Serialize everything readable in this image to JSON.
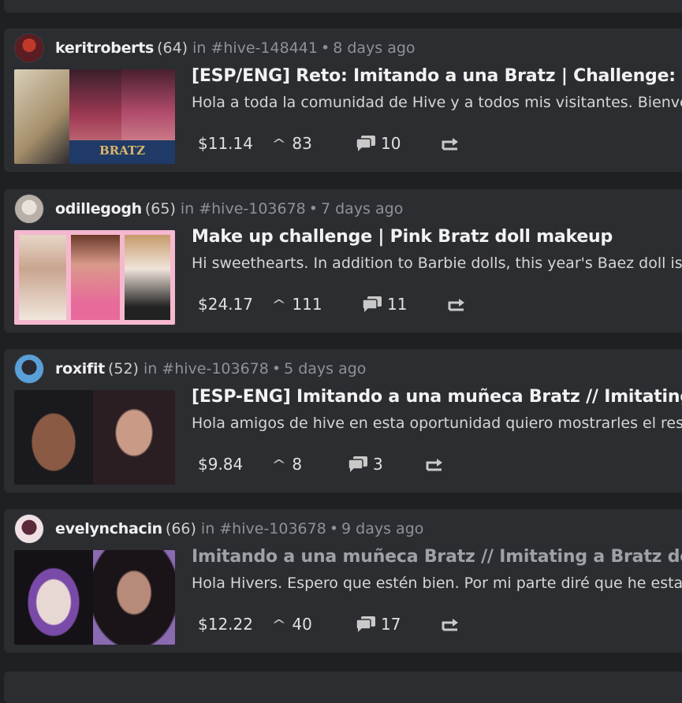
{
  "colors": {
    "background": "#1e2022",
    "card": "#2b2d31",
    "muted_text": "#8e9196",
    "visited_title": "#9ea2a7"
  },
  "icons": {
    "upvote": "chevron-up-icon",
    "comments": "comments-icon",
    "reblog": "reblog-icon"
  },
  "posts": [
    {
      "author": "keritroberts",
      "reputation": "(64)",
      "in_label": "in",
      "community": "#hive-148441",
      "separator": "•",
      "time_ago": "8 days ago",
      "title": "[ESP/ENG] Reto: Imitando a una Bratz | Challenge: Imitating a Bratz",
      "summary": "Hola a toda la comunidad de Hive y a todos mis visitantes. Bienvenidos",
      "payout": "$11.14",
      "votes": "83",
      "comments": "10",
      "title_visited": false,
      "thumb_colors": [
        "#b9a98c",
        "#8a2a3c",
        "#3a2a44"
      ],
      "thumb_banner_text": "BRATZ"
    },
    {
      "author": "odillegogh",
      "reputation": "(65)",
      "in_label": "in",
      "community": "#hive-103678",
      "separator": "•",
      "time_ago": "7 days ago",
      "title": "Make up challenge | Pink Bratz doll makeup",
      "summary": "Hi sweethearts. In addition to Barbie dolls, this year's Baez doll is d",
      "payout": "$24.17",
      "votes": "111",
      "comments": "11",
      "title_visited": false,
      "thumb_colors": [
        "#f2a9c4",
        "#e58fb0",
        "#c86f8f"
      ],
      "thumb_banner_text": ""
    },
    {
      "author": "roxifit",
      "reputation": "(52)",
      "in_label": "in",
      "community": "#hive-103678",
      "separator": "•",
      "time_ago": "5 days ago",
      "title": "[ESP-ENG] Imitando a una muñeca Bratz // Imitating a Bratz doll",
      "summary": "Hola amigos de hive en esta oportunidad quiero mostrarles el resultado",
      "payout": "$9.84",
      "votes": "8",
      "comments": "3",
      "title_visited": false,
      "thumb_colors": [
        "#1b1a1f",
        "#7a4b3c",
        "#caa08a"
      ],
      "thumb_banner_text": ""
    },
    {
      "author": "evelynchacin",
      "reputation": "(66)",
      "in_label": "in",
      "community": "#hive-103678",
      "separator": "•",
      "time_ago": "9 days ago",
      "title": "Imitando a una muñeca Bratz // Imitating a Bratz doll",
      "summary": "Hola Hivers. Espero que estén bien. Por mi parte diré que he estado",
      "payout": "$12.22",
      "votes": "40",
      "comments": "17",
      "title_visited": true,
      "thumb_colors": [
        "#6b3a8a",
        "#2a1f2e",
        "#9a7aa8"
      ],
      "thumb_banner_text": ""
    }
  ]
}
